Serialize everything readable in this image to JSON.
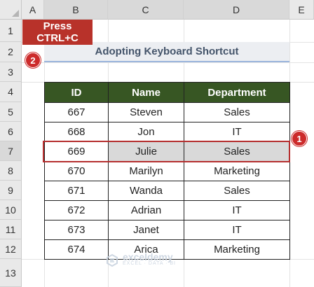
{
  "sheet": {
    "columns": [
      "A",
      "B",
      "C",
      "D",
      "E"
    ],
    "rows": [
      "1",
      "2",
      "3",
      "4",
      "5",
      "6",
      "7",
      "8",
      "9",
      "10",
      "11",
      "12",
      "13"
    ]
  },
  "callout": {
    "line1": "Press",
    "line2": "CTRL+C",
    "background": "#b8322a"
  },
  "title": "Adopting Keyboard Shortcut",
  "badges": {
    "step1": "1",
    "step2": "2",
    "color": "#cc2b2b"
  },
  "table": {
    "headers": [
      "ID",
      "Name",
      "Department"
    ],
    "header_color": "#375623",
    "rows": [
      [
        "667",
        "Steven",
        "Sales"
      ],
      [
        "668",
        "Jon",
        "IT"
      ],
      [
        "669",
        "Julie",
        "Sales"
      ],
      [
        "670",
        "Marilyn",
        "Marketing"
      ],
      [
        "671",
        "Wanda",
        "Sales"
      ],
      [
        "672",
        "Adrian",
        "IT"
      ],
      [
        "673",
        "Janet",
        "IT"
      ],
      [
        "674",
        "Arica",
        "Marketing"
      ]
    ],
    "selected_row": 2
  },
  "watermark": {
    "name": "exceldemy",
    "tagline": "EXCEL · DATA · BI"
  }
}
